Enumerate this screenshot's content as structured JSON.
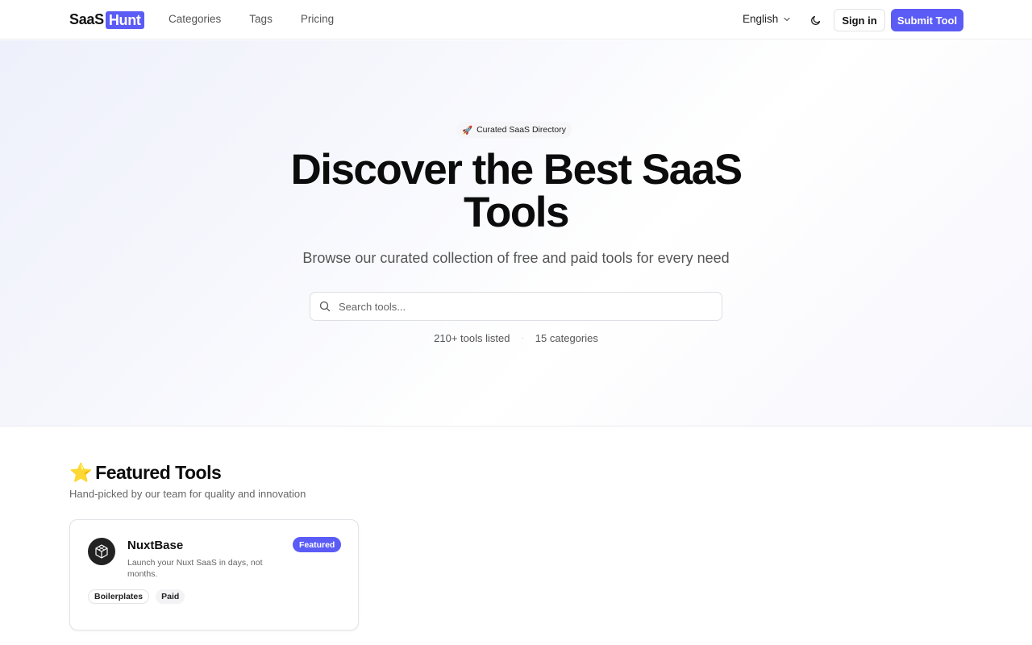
{
  "header": {
    "logo_part1": "SaaS",
    "logo_part2": "Hunt",
    "nav": [
      "Categories",
      "Tags",
      "Pricing"
    ],
    "language": "English",
    "signin_label": "Sign in",
    "submit_label": "Submit Tool"
  },
  "hero": {
    "pill_emoji": "🚀",
    "pill_text": "Curated SaaS Directory",
    "title_line1": "Discover the Best SaaS",
    "title_line2": "Tools",
    "subtitle": "Browse our curated collection of free and paid tools for every need",
    "search_placeholder": "Search tools...",
    "stat_tools": "210+ tools listed",
    "stat_separator": "·",
    "stat_categories": "15 categories"
  },
  "featured": {
    "emoji": "⭐",
    "title": "Featured Tools",
    "subtitle": "Hand-picked by our team for quality and innovation",
    "cards": [
      {
        "name": "NuxtBase",
        "description": "Launch your Nuxt SaaS in days, not months.",
        "badge": "Featured",
        "tags": [
          "Boilerplates",
          "Paid"
        ]
      }
    ]
  },
  "colors": {
    "accent": "#5b5bf6"
  }
}
